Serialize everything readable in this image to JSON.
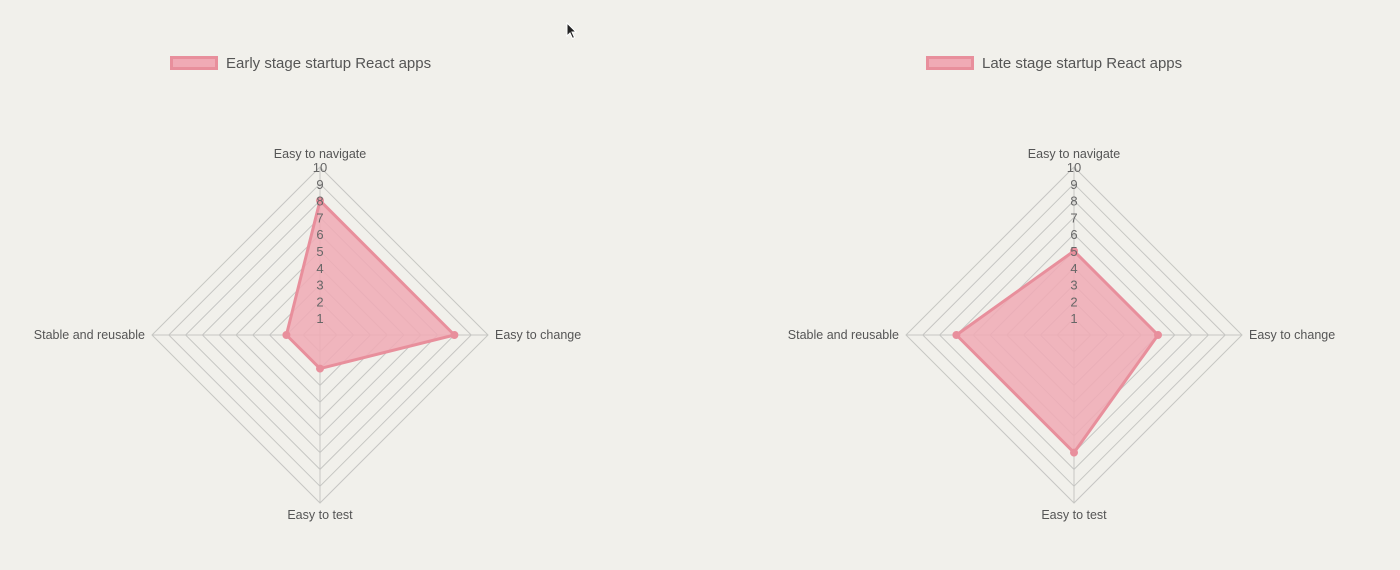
{
  "chart_data": [
    {
      "type": "radar",
      "legend": "Early stage startup React apps",
      "legend_position": "top-left",
      "axes": [
        "Easy to navigate",
        "Easy to change",
        "Easy to test",
        "Stable and reusable"
      ],
      "ticks": [
        1,
        2,
        3,
        4,
        5,
        6,
        7,
        8,
        9,
        10
      ],
      "range": [
        0,
        10
      ],
      "series": [
        {
          "name": "Early stage startup React apps",
          "values": [
            8,
            8,
            2,
            2
          ]
        }
      ],
      "color": "#f0aab5",
      "border_color": "#e88f9c"
    },
    {
      "type": "radar",
      "legend": "Late stage startup React apps",
      "legend_position": "top-left",
      "axes": [
        "Easy to navigate",
        "Easy to change",
        "Easy to test",
        "Stable and reusable"
      ],
      "ticks": [
        1,
        2,
        3,
        4,
        5,
        6,
        7,
        8,
        9,
        10
      ],
      "range": [
        0,
        10
      ],
      "series": [
        {
          "name": "Late stage startup React apps",
          "values": [
            5,
            5,
            7,
            7
          ]
        }
      ],
      "color": "#f0aab5",
      "border_color": "#e88f9c"
    }
  ]
}
